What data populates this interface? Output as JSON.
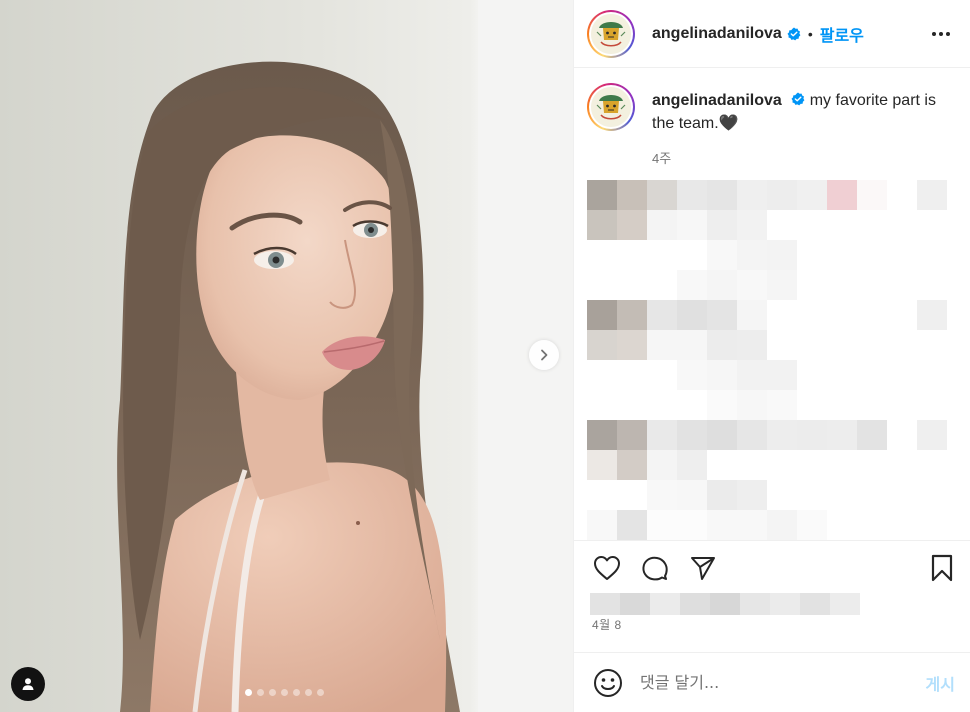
{
  "post": {
    "username": "angelinadanilova",
    "separator": "•",
    "follow_label": "팔로우",
    "caption": "my favorite part is the team.🖤",
    "caption_time": "4주",
    "date": "4월 8",
    "comment_placeholder": "댓글 달기...",
    "post_label": "게시",
    "carousel_total": 7,
    "carousel_active": 1
  },
  "icons": {
    "verified": "verified-badge-icon",
    "more": "more-horizontal-icon",
    "next": "chevron-right-icon",
    "tag": "user-tag-icon",
    "like": "heart-icon",
    "comment": "comment-icon",
    "share": "paper-plane-icon",
    "save": "bookmark-icon",
    "emoji": "emoji-smile-icon"
  },
  "colors": {
    "accent": "#0095f6",
    "verified": "#0095f6",
    "post_disabled": "#b2dffc",
    "muted": "#737373",
    "text": "#262626"
  },
  "comments_blurred": [
    [
      "#aaa49d",
      "#c8c0b8",
      "#d9d6d2",
      "#e8e8e8",
      "#e5e5e5",
      "#efefef",
      "#ededed",
      "#f0f0f0",
      "#f0cfd3",
      "#fbf8f8",
      "#ffffff",
      "#efefef"
    ],
    [
      "#c9c4bd",
      "#d5cdc6",
      "#f4f4f4",
      "#f7f7f7",
      "#eeeeee",
      "#f2f2f2",
      "#ffffff",
      "#ffffff",
      "#ffffff",
      "#ffffff",
      "#ffffff",
      "#ffffff"
    ],
    [
      "#ffffff",
      "#ffffff",
      "#ffffff",
      "#ffffff",
      "#f8f8f8",
      "#f4f4f4",
      "#f3f3f3",
      "#ffffff",
      "#ffffff",
      "#ffffff",
      "#ffffff",
      "#ffffff"
    ],
    [
      "#ffffff",
      "#ffffff",
      "#ffffff",
      "#f8f8f8",
      "#f5f5f5",
      "#f8f8f8",
      "#f5f5f5",
      "#ffffff",
      "#ffffff",
      "#ffffff",
      "#ffffff",
      "#ffffff"
    ],
    [
      "#a8a19a",
      "#c3bcb5",
      "#e6e6e6",
      "#e0e0e0",
      "#e4e4e4",
      "#f5f5f5",
      "#ffffff",
      "#ffffff",
      "#ffffff",
      "#ffffff",
      "#ffffff",
      "#efefef"
    ],
    [
      "#d8d4cf",
      "#dcd6d0",
      "#f6f6f6",
      "#f6f6f6",
      "#ececec",
      "#ededed",
      "#ffffff",
      "#ffffff",
      "#ffffff",
      "#ffffff",
      "#ffffff",
      "#ffffff"
    ],
    [
      "#ffffff",
      "#ffffff",
      "#ffffff",
      "#f8f8f8",
      "#f6f6f6",
      "#f2f2f2",
      "#f2f2f2",
      "#ffffff",
      "#ffffff",
      "#ffffff",
      "#ffffff",
      "#ffffff"
    ],
    [
      "#ffffff",
      "#ffffff",
      "#ffffff",
      "#ffffff",
      "#fafafa",
      "#f7f7f7",
      "#f9f9f9",
      "#ffffff",
      "#ffffff",
      "#ffffff",
      "#ffffff",
      "#ffffff"
    ],
    [
      "#aaa49e",
      "#bdb6b0",
      "#e9e9e9",
      "#e2e2e2",
      "#dedede",
      "#e6e6e6",
      "#ededed",
      "#ececec",
      "#ededed",
      "#e3e3e3",
      "#ffffff",
      "#efefef"
    ],
    [
      "#ece8e4",
      "#d3ccc6",
      "#f4f4f4",
      "#eeeeee",
      "#ffffff",
      "#ffffff",
      "#ffffff",
      "#ffffff",
      "#ffffff",
      "#ffffff",
      "#ffffff",
      "#ffffff"
    ],
    [
      "#ffffff",
      "#ffffff",
      "#f8f8f8",
      "#f7f7f7",
      "#ebebeb",
      "#eeeeee",
      "#ffffff",
      "#ffffff",
      "#ffffff",
      "#ffffff",
      "#ffffff",
      "#ffffff"
    ],
    [
      "#f8f8f8",
      "#e4e4e4",
      "#fcfcfc",
      "#fcfcfc",
      "#f8f8f8",
      "#f8f8f8",
      "#f4f4f4",
      "#fafafa",
      "#ffffff",
      "#ffffff",
      "#ffffff",
      "#ffffff"
    ]
  ],
  "likes_blurred": [
    "#e3e3e3",
    "#d9d9d9",
    "#ebebeb",
    "#dedede",
    "#d7d7d7",
    "#e6e6e6",
    "#ebebeb",
    "#e2e2e2",
    "#ececec"
  ]
}
